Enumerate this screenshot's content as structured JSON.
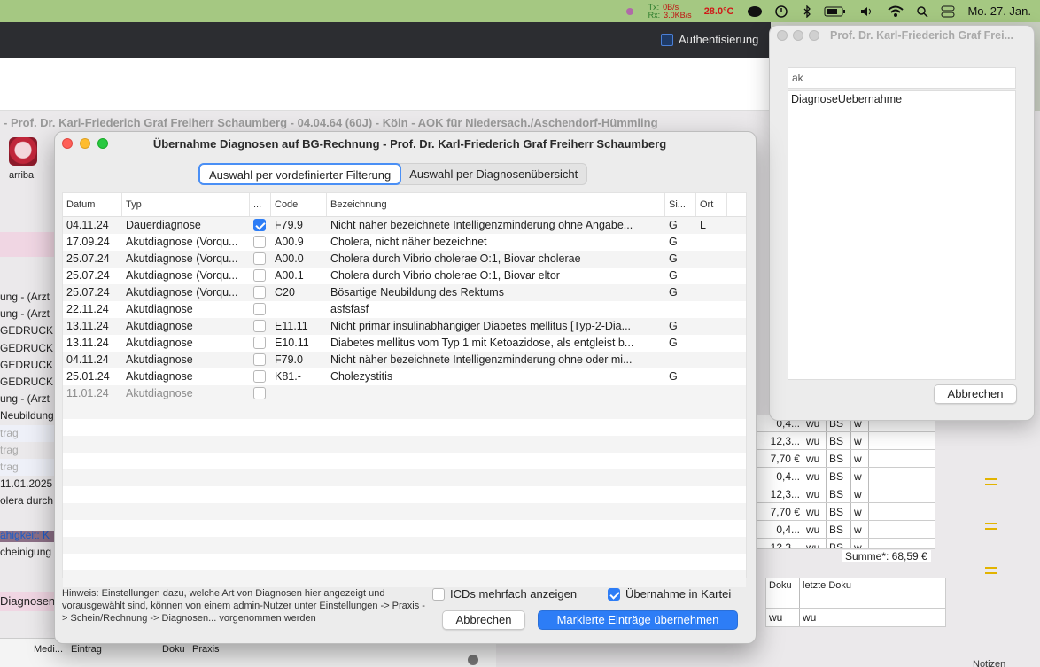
{
  "menubar": {
    "net_tx_label": "Tx:",
    "net_rx_label": "Rx:",
    "net_tx": "0B/s",
    "net_rx": "3.0KB/s",
    "temp": "28.0°C",
    "date": "Mo. 27. Jan."
  },
  "background": {
    "auth_label": "Authentisierung",
    "patient_header": "- Prof. Dr. Karl-Friederich Graf Freiherr Schaumberg - 04.04.64 (60J) - Köln - AOK für Niedersach./Aschendorf-Hümmling",
    "arriba_label": "arriba",
    "left_rows": [
      "ung - (Arzt",
      "ung - (Arzt",
      "GEDRUCK",
      "GEDRUCK",
      "GEDRUCK",
      "GEDRUCK",
      "ung - (Arzt",
      "Neubildung",
      "trag",
      "trag",
      "trag",
      "11.01.2025",
      "olera durch",
      "",
      "ähigkeit: K",
      "cheinigung"
    ],
    "right_rows": [
      [
        "0,4...",
        "wu",
        "BS",
        "w"
      ],
      [
        "12,3...",
        "wu",
        "BS",
        "w"
      ],
      [
        "7,70 €",
        "wu",
        "BS",
        "w"
      ],
      [
        "0,4...",
        "wu",
        "BS",
        "w"
      ],
      [
        "12,3...",
        "wu",
        "BS",
        "w"
      ],
      [
        "7,70 €",
        "wu",
        "BS",
        "w"
      ],
      [
        "0,4...",
        "wu",
        "BS",
        "w"
      ],
      [
        "12,3...",
        "wu",
        "BS",
        "w"
      ]
    ],
    "summe": "Summe*: 68,59 €",
    "doku_col": "Doku",
    "letzte_doku_col": "letzte Doku",
    "doku_val": "wu",
    "letzte_doku_val": "wu",
    "diagnosen_label": "Diagnosen",
    "bottom_cols": [
      "Medi...",
      "Eintrag",
      "Doku",
      "Praxis"
    ],
    "notizen": "Notizen"
  },
  "popup": {
    "title": "Prof. Dr. Karl-Friederich Graf Frei...",
    "search_value": "ak",
    "items": [
      "DiagnoseUebernahme"
    ],
    "cancel_label": "Abbrechen"
  },
  "dialog": {
    "title": "Übernahme Diagnosen auf BG-Rechnung - Prof. Dr. Karl-Friederich Graf Freiherr Schaumberg",
    "tabs": [
      {
        "label": "Auswahl per vordefinierter Filterung",
        "active": true
      },
      {
        "label": "Auswahl per Diagnosenübersicht",
        "active": false
      }
    ],
    "columns": {
      "datum": "Datum",
      "typ": "Typ",
      "chk": "...",
      "code": "Code",
      "bez": "Bezeichnung",
      "si": "Si...",
      "ort": "Ort"
    },
    "rows": [
      {
        "datum": "04.11.24",
        "typ": "Dauerdiagnose",
        "checked": true,
        "code": "F79.9",
        "bez": "Nicht näher bezeichnete Intelligenzminderung ohne Angabe...",
        "si": "G",
        "ort": "L"
      },
      {
        "datum": "17.09.24",
        "typ": "Akutdiagnose (Vorqu...",
        "checked": false,
        "code": "A00.9",
        "bez": "Cholera, nicht näher bezeichnet",
        "si": "G",
        "ort": ""
      },
      {
        "datum": "25.07.24",
        "typ": "Akutdiagnose (Vorqu...",
        "checked": false,
        "code": "A00.0",
        "bez": "Cholera durch Vibrio cholerae O:1, Biovar cholerae",
        "si": "G",
        "ort": ""
      },
      {
        "datum": "25.07.24",
        "typ": "Akutdiagnose (Vorqu...",
        "checked": false,
        "code": "A00.1",
        "bez": "Cholera durch Vibrio cholerae O:1, Biovar eltor",
        "si": "G",
        "ort": ""
      },
      {
        "datum": "25.07.24",
        "typ": "Akutdiagnose (Vorqu...",
        "checked": false,
        "code": "C20",
        "bez": "Bösartige Neubildung des Rektums",
        "si": "G",
        "ort": ""
      },
      {
        "datum": "22.11.24",
        "typ": "Akutdiagnose",
        "checked": false,
        "code": "",
        "bez": "asfsfasf",
        "si": "",
        "ort": ""
      },
      {
        "datum": "13.11.24",
        "typ": "Akutdiagnose",
        "checked": false,
        "code": "E11.11",
        "bez": "Nicht primär insulinabhängiger Diabetes mellitus [Typ-2-Dia...",
        "si": "G",
        "ort": ""
      },
      {
        "datum": "13.11.24",
        "typ": "Akutdiagnose",
        "checked": false,
        "code": "E10.11",
        "bez": "Diabetes mellitus vom Typ 1 mit Ketoazidose, als entgleist b...",
        "si": "G",
        "ort": ""
      },
      {
        "datum": "04.11.24",
        "typ": "Akutdiagnose",
        "checked": false,
        "code": "F79.0",
        "bez": "Nicht näher bezeichnete Intelligenzminderung ohne oder mi...",
        "si": "",
        "ort": ""
      },
      {
        "datum": "25.01.24",
        "typ": "Akutdiagnose",
        "checked": false,
        "code": "K81.-",
        "bez": "Cholezystitis",
        "si": "G",
        "ort": ""
      },
      {
        "datum": "11.01.24",
        "typ": "Akutdiagnose",
        "checked": false,
        "code": "",
        "bez": "",
        "si": "",
        "ort": "",
        "dim": true
      }
    ],
    "hint": "Hinweis: Einstellungen dazu, welche Art von Diagnosen hier angezeigt und vorausgewählt sind, können von einem admin-Nutzer unter Einstellungen -> Praxis -> Schein/Rechnung -> Diagnosen... vorgenommen werden",
    "opt_multi_label": "ICDs mehrfach anzeigen",
    "opt_multi_checked": false,
    "opt_kartei_label": "Übernahme in Kartei",
    "opt_kartei_checked": true,
    "cancel_label": "Abbrechen",
    "ok_label": "Markierte Einträge übernehmen"
  }
}
